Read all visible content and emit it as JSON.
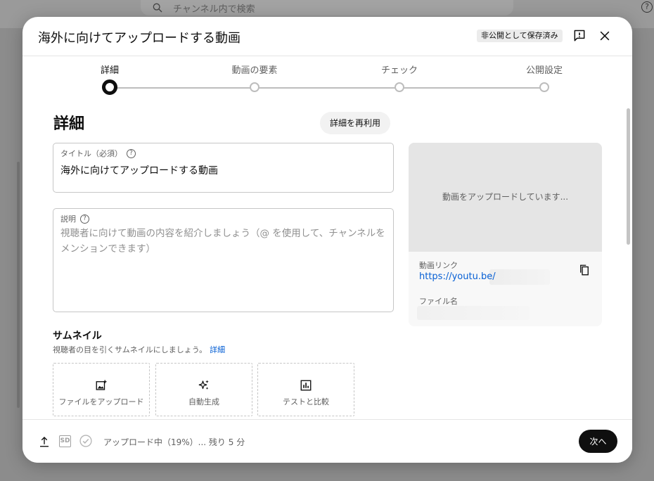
{
  "backdrop": {
    "search_placeholder": "チャンネル内で検索",
    "help": "?"
  },
  "header": {
    "title": "海外に向けてアップロードする動画",
    "save_status": "非公開として保存済み",
    "icons": [
      "feedback-icon",
      "close-icon"
    ]
  },
  "stepper": {
    "steps": [
      {
        "label": "詳細",
        "active": true
      },
      {
        "label": "動画の要素",
        "active": false
      },
      {
        "label": "チェック",
        "active": false
      },
      {
        "label": "公開設定",
        "active": false
      }
    ]
  },
  "details": {
    "section_title": "詳細",
    "reuse_label": "詳細を再利用",
    "title_field": {
      "label": "タイトル（必須）",
      "help": "?",
      "value": "海外に向けてアップロードする動画"
    },
    "description_field": {
      "label": "説明",
      "help": "?",
      "placeholder": "視聴者に向けて動画の内容を紹介しましょう（@ を使用して、チャンネルをメンションできます）"
    }
  },
  "thumbnail": {
    "title": "サムネイル",
    "subtitle": "視聴者の目を引くサムネイルにしましょう。",
    "more_link": "詳細",
    "options": [
      {
        "label": "ファイルをアップロード",
        "icon": "add-photo-icon"
      },
      {
        "label": "自動生成",
        "icon": "sparkle-icon"
      },
      {
        "label": "テストと比較",
        "icon": "bar-chart-icon"
      }
    ]
  },
  "preview": {
    "uploading_text": "動画をアップロードしています...",
    "link_label": "動画リンク",
    "link_url": "https://youtu.be/",
    "file_label": "ファイル名"
  },
  "footer": {
    "status": "アップロード中（19%）... 残り 5 分",
    "sd_badge": "SD",
    "next_label": "次へ"
  },
  "colors": {
    "accent_link": "#065fd4",
    "primary_button": "#0f0f0f"
  }
}
